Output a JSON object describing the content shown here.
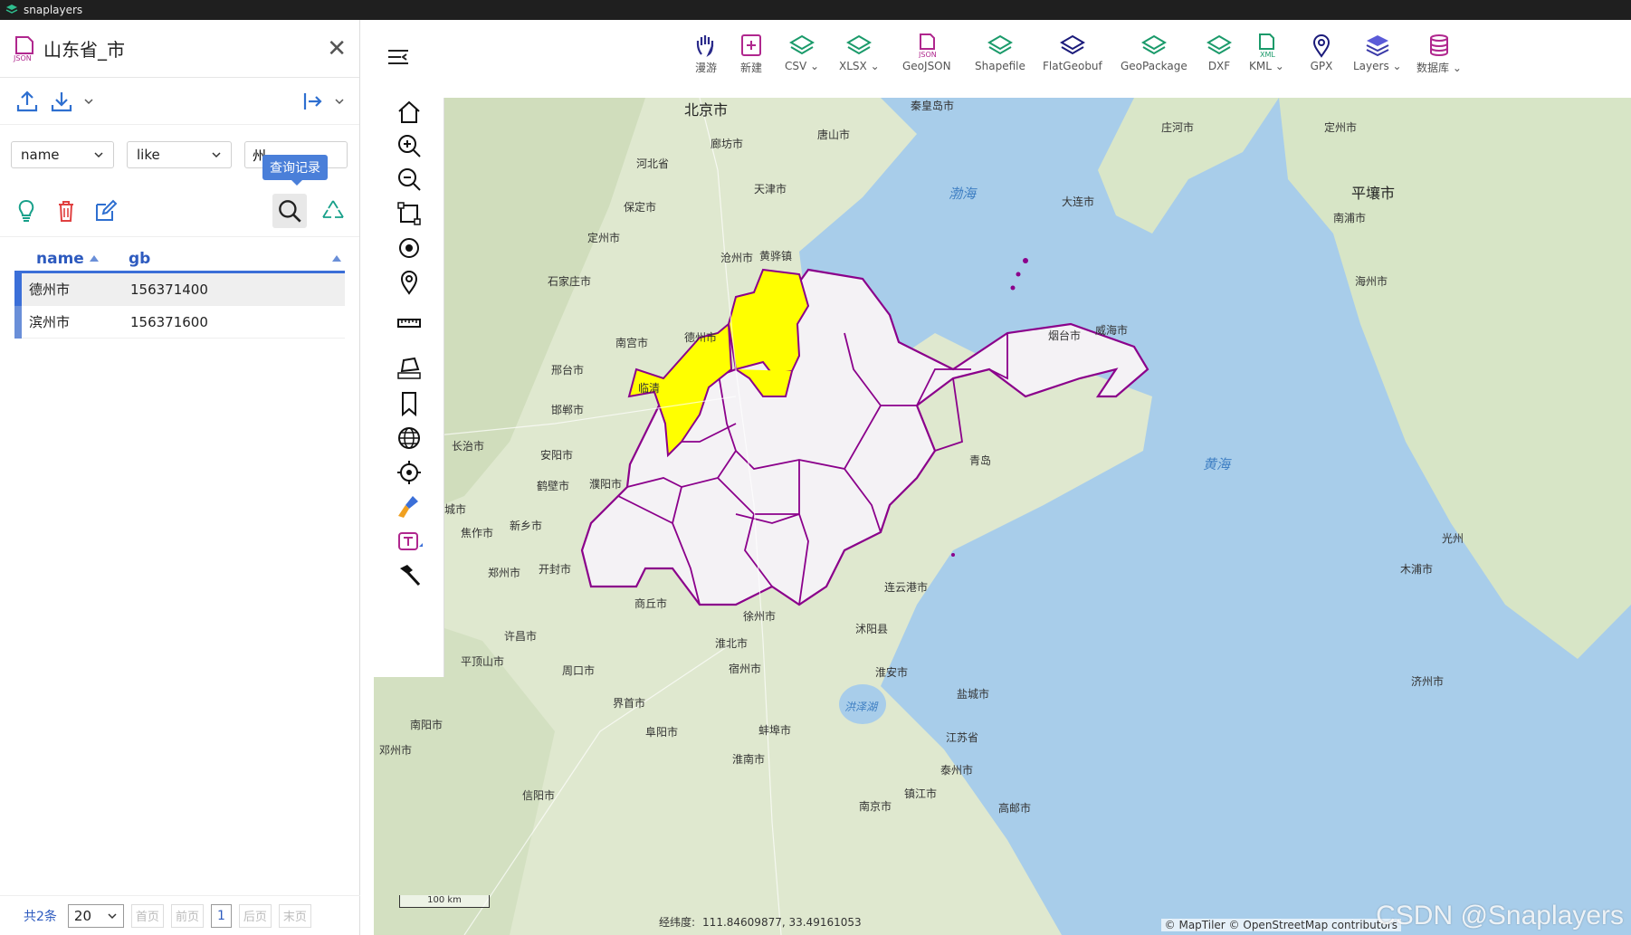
{
  "app": {
    "title": "snaplayers"
  },
  "panel": {
    "layer_title": "山东省_市",
    "query": {
      "field": "name",
      "operator": "like",
      "value": "州",
      "tooltip": "查询记录"
    },
    "table": {
      "headers": [
        "name",
        "gb"
      ],
      "rows": [
        {
          "name": "德州市",
          "gb": "156371400"
        },
        {
          "name": "滨州市",
          "gb": "156371600"
        }
      ]
    },
    "pager": {
      "total": "共2条",
      "page_size": "20",
      "first": "首页",
      "prev": "前页",
      "page": "1",
      "next": "后页",
      "last": "末页"
    }
  },
  "toolbar": {
    "items": [
      {
        "label": "漫游",
        "icon": "hand-icon"
      },
      {
        "label": "新建",
        "icon": "new-icon"
      },
      {
        "label": "CSV",
        "icon": "layers-icon"
      },
      {
        "label": "XLSX",
        "icon": "layers-icon"
      },
      {
        "label": "GeoJSON",
        "icon": "json-file-icon"
      },
      {
        "label": "Shapefile",
        "icon": "layers-icon"
      },
      {
        "label": "FlatGeobuf",
        "icon": "layers-icon"
      },
      {
        "label": "GeoPackage",
        "icon": "layers-icon"
      },
      {
        "label": "DXF",
        "icon": "layers-icon"
      },
      {
        "label": "KML",
        "icon": "xml-file-icon"
      },
      {
        "label": "GPX",
        "icon": "pin-icon"
      },
      {
        "label": "Layers",
        "icon": "stack-icon"
      },
      {
        "label": "数据库",
        "icon": "database-icon"
      }
    ]
  },
  "map": {
    "cities": [
      "北京市",
      "秦皇岛市",
      "庄河市",
      "定州市",
      "廊坊市",
      "唐山市",
      "天津市",
      "河北省",
      "保定市",
      "大连市",
      "平壤市",
      "南浦市",
      "定州市",
      "沧州市",
      "黄骅镇",
      "石家庄市",
      "南宫市",
      "德州市",
      "邢台市",
      "烟台市",
      "威海市",
      "海州市",
      "邯郸市",
      "临清",
      "长治市",
      "安阳市",
      "鹤壁市",
      "濮阳市",
      "晋城市",
      "焦作市",
      "新乡市",
      "郑州市",
      "开封市",
      "商丘市",
      "徐州市",
      "连云港市",
      "沭阳县",
      "许昌市",
      "淮北市",
      "平顶山市",
      "周口市",
      "宿州市",
      "淮安市",
      "盐城市",
      "界首市",
      "阜阳市",
      "蚌埠市",
      "南阳市",
      "淮南市",
      "泰州市",
      "邓州市",
      "信阳市",
      "镇江市",
      "南京市",
      "青岛",
      "江苏省",
      "光州",
      "木浦市",
      "济州市",
      "高邮市",
      "德州市"
    ],
    "seas": {
      "bohai": "渤海",
      "yellow": "黄海",
      "lake": "洪泽湖"
    },
    "scale": "100 km",
    "coord_label": "经纬度:",
    "coords": "111.84609877, 33.49161053",
    "attribution": "© MapTiler © OpenStreetMap contributors",
    "watermark": "CSDN @Snaplayers",
    "colors": {
      "highlight": "#ffff00",
      "outline": "#8b008b",
      "fill": "#f4f2f5",
      "sea": "#a8cdea"
    }
  }
}
